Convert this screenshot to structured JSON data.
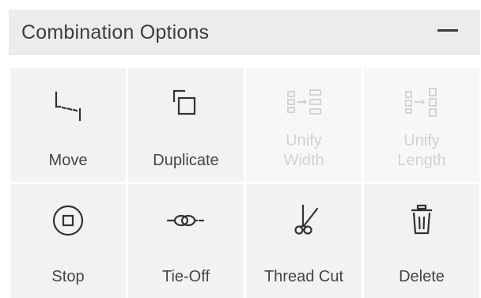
{
  "panel": {
    "title": "Combination Options",
    "collapse_icon": "minus-icon"
  },
  "tools": [
    {
      "label": "Move",
      "icon": "move-icon",
      "enabled": true
    },
    {
      "label": "Duplicate",
      "icon": "duplicate-icon",
      "enabled": true
    },
    {
      "label_line1": "Unify",
      "label_line2": "Width",
      "icon": "unify-width-icon",
      "enabled": false
    },
    {
      "label_line1": "Unify",
      "label_line2": "Length",
      "icon": "unify-length-icon",
      "enabled": false
    },
    {
      "label": "Stop",
      "icon": "stop-icon",
      "enabled": true
    },
    {
      "label": "Tie-Off",
      "icon": "tie-off-icon",
      "enabled": true
    },
    {
      "label": "Thread Cut",
      "icon": "scissors-icon",
      "enabled": true
    },
    {
      "label": "Delete",
      "icon": "trash-icon",
      "enabled": true
    }
  ],
  "colors": {
    "header_bg": "#ececec",
    "tile_bg": "#f2f2f2",
    "tile_disabled_bg": "#f7f7f7",
    "text": "#454545",
    "text_disabled": "#d2d2d2"
  }
}
